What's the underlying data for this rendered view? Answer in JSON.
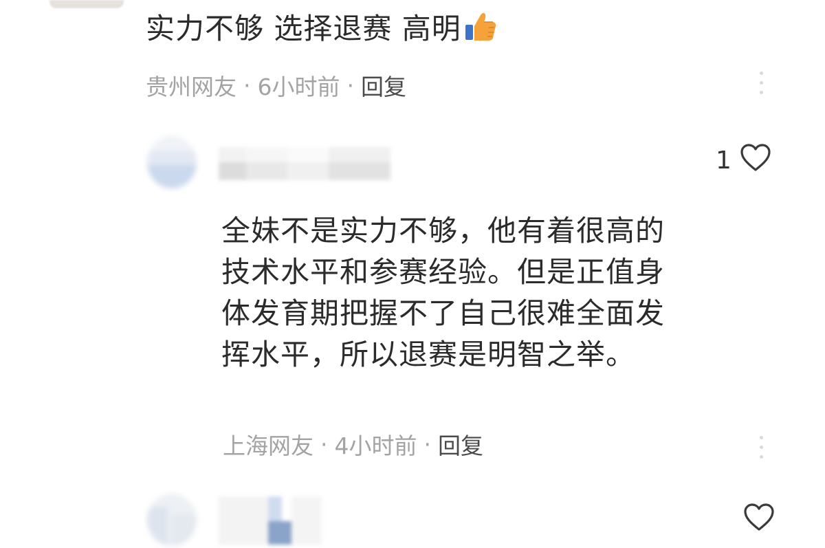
{
  "colors": {
    "text_primary": "#2b2b2b",
    "text_meta": "#a3a3a3",
    "reply": "#4a4a4a",
    "background": "#ffffff"
  },
  "comments": [
    {
      "text": "实力不够 选择退赛 高明",
      "emoji": "thumbs-up",
      "location": "贵州网友",
      "time": "6小时前",
      "reply_label": "回复"
    },
    {
      "likes": "1",
      "text_lines": [
        "全妹不是实力不够，他有着很高的",
        "技术水平和参赛经验。但是正值身",
        "体发育期把握不了自己很难全面发",
        "挥水平，所以退赛是明智之举。"
      ],
      "location": "上海网友",
      "time": "4小时前",
      "reply_label": "回复"
    },
    {
      "likes": ""
    }
  ],
  "separator": "·"
}
